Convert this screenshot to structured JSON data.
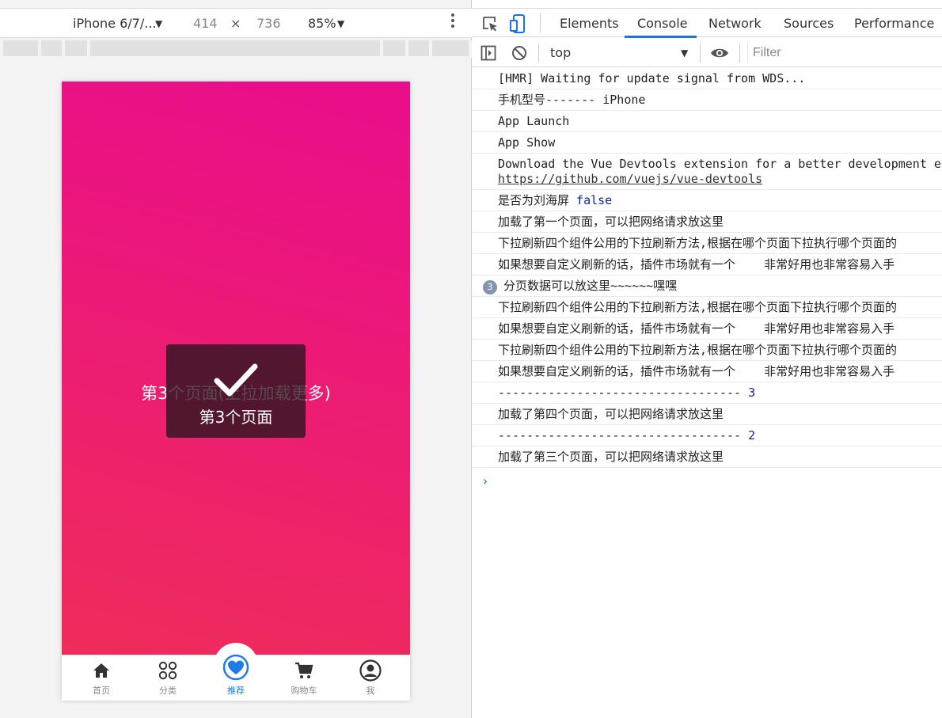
{
  "device_toolbar": {
    "device_name": "iPhone 6/7/...",
    "dropdown_glyph": "▼",
    "width": "414",
    "times": "×",
    "height": "736",
    "zoom": "85%",
    "more_icon": "more-vert-icon"
  },
  "phone": {
    "page_text": "第3个页面(上拉加载更多)",
    "toast_text": "第3个页面",
    "gradient_colors": [
      "#ea0d8c",
      "#ef2c5a"
    ],
    "tabbar": [
      {
        "label": "首页",
        "icon": "home-icon"
      },
      {
        "label": "分类",
        "icon": "grid-icon"
      },
      {
        "label": "推荐",
        "icon": "heart-icon",
        "active": true
      },
      {
        "label": "购物车",
        "icon": "cart-icon"
      },
      {
        "label": "我",
        "icon": "user-icon"
      }
    ],
    "active_color": "#1e7ce8"
  },
  "devtools": {
    "tabs": [
      "Elements",
      "Console",
      "Network",
      "Sources",
      "Performance"
    ],
    "active_tab": "Console",
    "context": "top",
    "filter_placeholder": "Filter",
    "prompt": "›",
    "logs": [
      {
        "text": "[HMR] Waiting for update signal from WDS..."
      },
      {
        "text": "手机型号------- iPhone"
      },
      {
        "text": "App Launch"
      },
      {
        "text": "App Show"
      },
      {
        "text": "Download the Vue Devtools extension for a better development e",
        "link": "https://github.com/vuejs/vue-devtools"
      },
      {
        "text": "是否为刘海屏 ",
        "value": "false"
      },
      {
        "text": "加载了第一个页面，可以把网络请求放这里"
      },
      {
        "text": "下拉刷新四个组件公用的下拉刷新方法,根据在哪个页面下拉执行哪个页面的"
      },
      {
        "text": "如果想要自定义刷新的话，插件市场就有一个    非常好用也非常容易入手"
      },
      {
        "text": "分页数据可以放这里~~~~~~嘿嘿",
        "badge": "3"
      },
      {
        "text": "下拉刷新四个组件公用的下拉刷新方法,根据在哪个页面下拉执行哪个页面的"
      },
      {
        "text": "如果想要自定义刷新的话，插件市场就有一个    非常好用也非常容易入手"
      },
      {
        "text": "下拉刷新四个组件公用的下拉刷新方法,根据在哪个页面下拉执行哪个页面的"
      },
      {
        "text": "如果想要自定义刷新的话，插件市场就有一个    非常好用也非常容易入手"
      },
      {
        "text": "---------------------------------- ",
        "value": "3"
      },
      {
        "text": "加载了第四个页面，可以把网络请求放这里"
      },
      {
        "text": "---------------------------------- ",
        "value": "2"
      },
      {
        "text": "加载了第三个页面，可以把网络请求放这里"
      }
    ]
  }
}
